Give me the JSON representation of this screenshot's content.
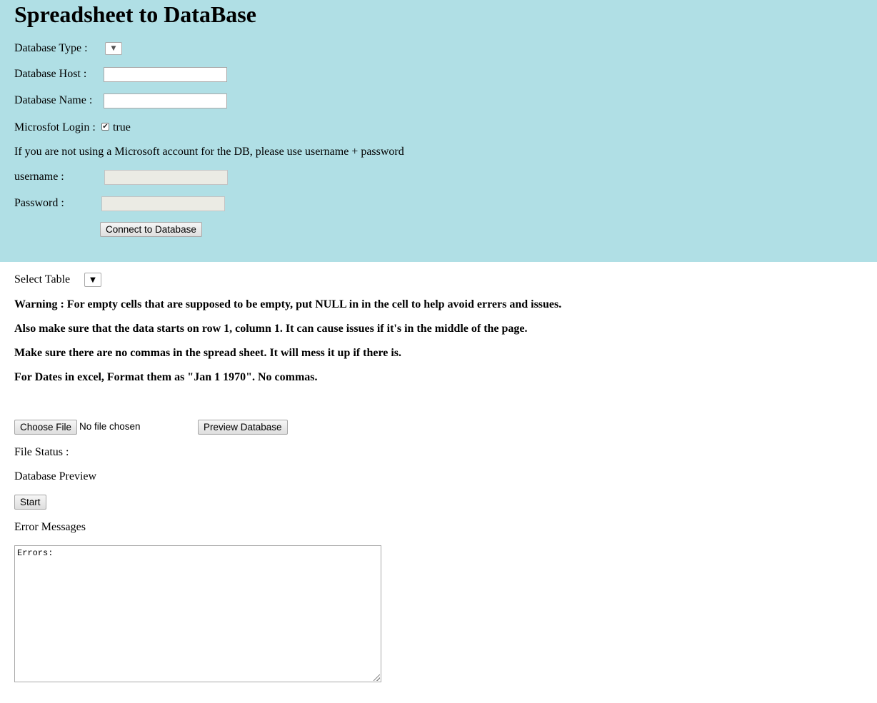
{
  "header": {
    "title": "Spreadsheet to DataBase"
  },
  "connection_form": {
    "db_type_label": "Database Type :",
    "db_host_label": "Database Host :",
    "db_host_value": "",
    "db_name_label": "Database Name :",
    "db_name_value": "",
    "ms_login_label": "Microsfot Login :",
    "ms_login_checked": true,
    "ms_login_value_text": "true",
    "ms_account_note": "If you are not using a Microsoft account for the DB, please use username + password",
    "username_label": "username :",
    "username_value": "",
    "password_label": "Password :",
    "password_value": "",
    "connect_button": "Connect to Database"
  },
  "table_section": {
    "select_table_label": "Select Table",
    "warnings": [
      "Warning : For empty cells that are supposed to be empty, put NULL in in the cell to help avoid errers and issues.",
      "Also make sure that the data starts on row 1, column 1. It can cause issues if it's in the middle of the page.",
      "Make sure there are no commas in the spread sheet. It will mess it up if there is.",
      "For Dates in excel, Format them as \"Jan 1 1970\". No commas."
    ]
  },
  "file_section": {
    "choose_file_button": "Choose File",
    "file_chosen_text": "No file chosen",
    "preview_button": "Preview Database",
    "file_status_label": "File Status :",
    "database_preview_label": "Database Preview",
    "start_button": "Start",
    "error_messages_label": "Error Messages",
    "errors_textarea_value": "Errors:"
  },
  "icons": {
    "dropdown_arrow": "chevron-down-icon",
    "checkbox_check": "check-icon"
  }
}
